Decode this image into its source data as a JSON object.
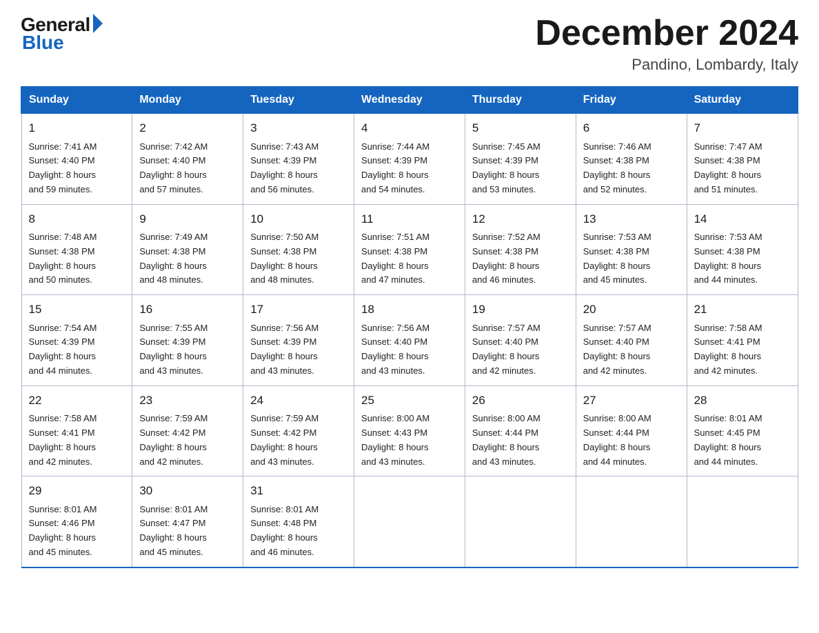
{
  "header": {
    "logo_general": "General",
    "logo_blue": "Blue",
    "month_title": "December 2024",
    "location": "Pandino, Lombardy, Italy"
  },
  "days_of_week": [
    "Sunday",
    "Monday",
    "Tuesday",
    "Wednesday",
    "Thursday",
    "Friday",
    "Saturday"
  ],
  "weeks": [
    [
      {
        "day": "1",
        "sunrise": "7:41 AM",
        "sunset": "4:40 PM",
        "daylight": "8 hours and 59 minutes."
      },
      {
        "day": "2",
        "sunrise": "7:42 AM",
        "sunset": "4:40 PM",
        "daylight": "8 hours and 57 minutes."
      },
      {
        "day": "3",
        "sunrise": "7:43 AM",
        "sunset": "4:39 PM",
        "daylight": "8 hours and 56 minutes."
      },
      {
        "day": "4",
        "sunrise": "7:44 AM",
        "sunset": "4:39 PM",
        "daylight": "8 hours and 54 minutes."
      },
      {
        "day": "5",
        "sunrise": "7:45 AM",
        "sunset": "4:39 PM",
        "daylight": "8 hours and 53 minutes."
      },
      {
        "day": "6",
        "sunrise": "7:46 AM",
        "sunset": "4:38 PM",
        "daylight": "8 hours and 52 minutes."
      },
      {
        "day": "7",
        "sunrise": "7:47 AM",
        "sunset": "4:38 PM",
        "daylight": "8 hours and 51 minutes."
      }
    ],
    [
      {
        "day": "8",
        "sunrise": "7:48 AM",
        "sunset": "4:38 PM",
        "daylight": "8 hours and 50 minutes."
      },
      {
        "day": "9",
        "sunrise": "7:49 AM",
        "sunset": "4:38 PM",
        "daylight": "8 hours and 48 minutes."
      },
      {
        "day": "10",
        "sunrise": "7:50 AM",
        "sunset": "4:38 PM",
        "daylight": "8 hours and 48 minutes."
      },
      {
        "day": "11",
        "sunrise": "7:51 AM",
        "sunset": "4:38 PM",
        "daylight": "8 hours and 47 minutes."
      },
      {
        "day": "12",
        "sunrise": "7:52 AM",
        "sunset": "4:38 PM",
        "daylight": "8 hours and 46 minutes."
      },
      {
        "day": "13",
        "sunrise": "7:53 AM",
        "sunset": "4:38 PM",
        "daylight": "8 hours and 45 minutes."
      },
      {
        "day": "14",
        "sunrise": "7:53 AM",
        "sunset": "4:38 PM",
        "daylight": "8 hours and 44 minutes."
      }
    ],
    [
      {
        "day": "15",
        "sunrise": "7:54 AM",
        "sunset": "4:39 PM",
        "daylight": "8 hours and 44 minutes."
      },
      {
        "day": "16",
        "sunrise": "7:55 AM",
        "sunset": "4:39 PM",
        "daylight": "8 hours and 43 minutes."
      },
      {
        "day": "17",
        "sunrise": "7:56 AM",
        "sunset": "4:39 PM",
        "daylight": "8 hours and 43 minutes."
      },
      {
        "day": "18",
        "sunrise": "7:56 AM",
        "sunset": "4:40 PM",
        "daylight": "8 hours and 43 minutes."
      },
      {
        "day": "19",
        "sunrise": "7:57 AM",
        "sunset": "4:40 PM",
        "daylight": "8 hours and 42 minutes."
      },
      {
        "day": "20",
        "sunrise": "7:57 AM",
        "sunset": "4:40 PM",
        "daylight": "8 hours and 42 minutes."
      },
      {
        "day": "21",
        "sunrise": "7:58 AM",
        "sunset": "4:41 PM",
        "daylight": "8 hours and 42 minutes."
      }
    ],
    [
      {
        "day": "22",
        "sunrise": "7:58 AM",
        "sunset": "4:41 PM",
        "daylight": "8 hours and 42 minutes."
      },
      {
        "day": "23",
        "sunrise": "7:59 AM",
        "sunset": "4:42 PM",
        "daylight": "8 hours and 42 minutes."
      },
      {
        "day": "24",
        "sunrise": "7:59 AM",
        "sunset": "4:42 PM",
        "daylight": "8 hours and 43 minutes."
      },
      {
        "day": "25",
        "sunrise": "8:00 AM",
        "sunset": "4:43 PM",
        "daylight": "8 hours and 43 minutes."
      },
      {
        "day": "26",
        "sunrise": "8:00 AM",
        "sunset": "4:44 PM",
        "daylight": "8 hours and 43 minutes."
      },
      {
        "day": "27",
        "sunrise": "8:00 AM",
        "sunset": "4:44 PM",
        "daylight": "8 hours and 44 minutes."
      },
      {
        "day": "28",
        "sunrise": "8:01 AM",
        "sunset": "4:45 PM",
        "daylight": "8 hours and 44 minutes."
      }
    ],
    [
      {
        "day": "29",
        "sunrise": "8:01 AM",
        "sunset": "4:46 PM",
        "daylight": "8 hours and 45 minutes."
      },
      {
        "day": "30",
        "sunrise": "8:01 AM",
        "sunset": "4:47 PM",
        "daylight": "8 hours and 45 minutes."
      },
      {
        "day": "31",
        "sunrise": "8:01 AM",
        "sunset": "4:48 PM",
        "daylight": "8 hours and 46 minutes."
      },
      {
        "day": "",
        "sunrise": "",
        "sunset": "",
        "daylight": ""
      },
      {
        "day": "",
        "sunrise": "",
        "sunset": "",
        "daylight": ""
      },
      {
        "day": "",
        "sunrise": "",
        "sunset": "",
        "daylight": ""
      },
      {
        "day": "",
        "sunrise": "",
        "sunset": "",
        "daylight": ""
      }
    ]
  ],
  "labels": {
    "sunrise": "Sunrise:",
    "sunset": "Sunset:",
    "daylight": "Daylight:"
  }
}
